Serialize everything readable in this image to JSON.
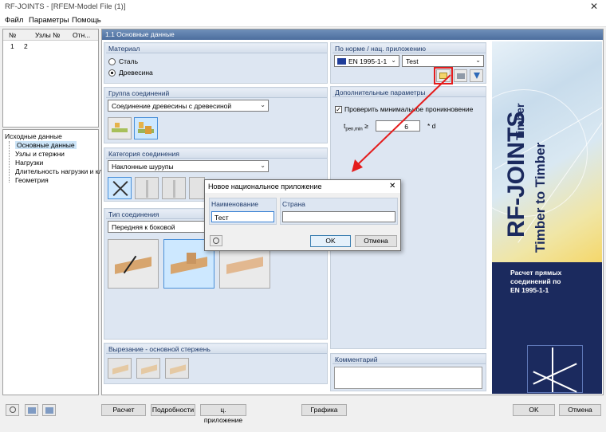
{
  "window": {
    "title": "RF-JOINTS - [RFEM-Model File (1)]",
    "close_glyph": "✕"
  },
  "menu": [
    "Файл",
    "Параметры",
    "Помощь"
  ],
  "left_table": {
    "headers": [
      "№",
      "Узлы №",
      "Отн..."
    ],
    "row": [
      "1",
      "2"
    ]
  },
  "nav_tree": {
    "root": "Исходные данные",
    "items": [
      "Основные данные",
      "Узлы и стержни",
      "Нагрузки",
      "Длительность нагрузки и кла",
      "Геометрия"
    ]
  },
  "panel_header": "1.1 Основные данные",
  "material": {
    "title": "Материал",
    "options": [
      "Сталь",
      "Древесина"
    ],
    "selected": "Древесина"
  },
  "group": {
    "title": "Группа соединений",
    "value": "Соединение древесины с древесиной"
  },
  "category": {
    "title": "Категория соединения",
    "value": "Наклонные шурупы"
  },
  "joint_type": {
    "title": "Тип соединения",
    "value": "Передняя к боковой"
  },
  "notch": {
    "title": "Вырезание - основной стержень"
  },
  "norm": {
    "title": "По норме / нац. приложению",
    "code": "EN 1995-1-1",
    "annex": "Test",
    "flag_color": "#1f3d99"
  },
  "extra": {
    "title": "Дополнительные параметры",
    "check_label": "Проверить минимальное проникновение",
    "tpen_label": "t",
    "tpen_sub": "pen,min",
    "tpen_ge": "≥",
    "tpen_value": "6",
    "tpen_unit": "* d"
  },
  "comment": {
    "title": "Комментарий"
  },
  "banner": {
    "brand": "RF-JOINTS",
    "timber": "Timber",
    "subtitle": "Timber to Timber",
    "desc1": "Расчет прямых",
    "desc2": "соединений по",
    "desc3": "EN 1995-1-1",
    "dark": "#1b2a5e"
  },
  "dialog": {
    "title": "Новое национальное приложение",
    "name_label": "Наименование",
    "name_value": "Тест",
    "country_label": "Страна",
    "country_value": "",
    "ok": "OK",
    "cancel": "Отмена",
    "close_glyph": "✕"
  },
  "bottom": {
    "calc": "Расчет",
    "details": "Подробности",
    "annex": "ц. приложение",
    "graphics": "Графика",
    "ok": "OK",
    "cancel": "Отмена"
  },
  "colors": {
    "highlight": "#e41c1c",
    "arrow": "#e41c1c"
  }
}
